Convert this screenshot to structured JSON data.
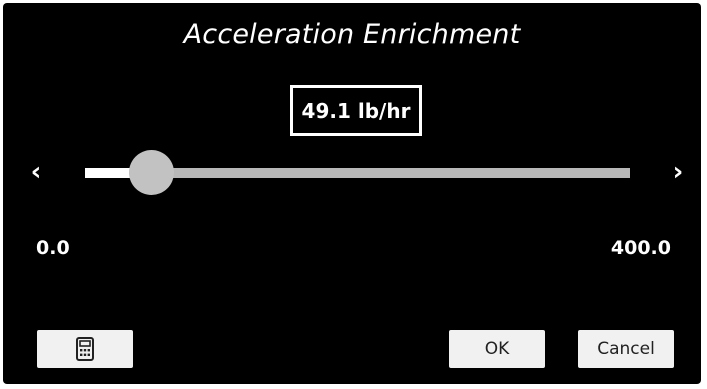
{
  "dialog": {
    "title": "Acceleration Enrichment",
    "value_display": "49.1 lb/hr"
  },
  "slider": {
    "min_label": "0.0",
    "max_label": "400.0",
    "min": 0.0,
    "max": 400.0,
    "value": 49.1,
    "prev_icon": "chevron-left-icon",
    "next_icon": "chevron-right-icon"
  },
  "buttons": {
    "calculator_icon": "calculator-icon",
    "ok_label": "OK",
    "cancel_label": "Cancel"
  },
  "colors": {
    "background": "#000000",
    "text": "#ffffff",
    "track": "#b9b8b9",
    "track_fill": "#ffffff",
    "thumb": "#c3c2c3",
    "button_bg": "#f2f1f2"
  }
}
